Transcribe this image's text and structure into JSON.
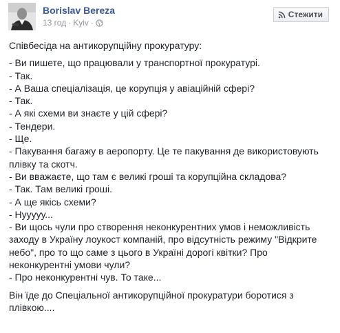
{
  "header": {
    "author_name": "Borislav Bereza",
    "time": "13 год",
    "separator": "·",
    "location": "Kyiv",
    "privacy_icon": "globe-icon",
    "follow_icon": "rss-icon",
    "follow_label": "Стежити"
  },
  "post": {
    "intro": "Співбесіда на антикорупційну прокуратуру:",
    "lines": [
      "- Ви пишете, що працювали у транспортної прокуратурі.",
      "- Так.",
      "- А Ваша спеціалізація, це корупція у авіаційній сфері?",
      "- Так.",
      "- А які схеми ви знаєте у цій сфері?",
      "- Тендери.",
      "- Ще.",
      "- Пакування багажу в аеропорту. Це те пакування де використовують",
      "плівку та скотч.",
      "- Ви вважаєте, що там є великі гроші та корупційна складова?",
      "- Так. Там великі гроші.",
      "- А ще якісь схеми?",
      "- Нууууу...",
      "- Ви щось чули про створення неконкурентних умов і неможливість",
      "заходу в Україну лоукост компаній, про відсутність режиму \"Відкрите",
      "небо\", про то що саме з цього в Україні дорогі квітки? Про",
      "неконкурентні умови чули?",
      "- Про неконкурентні чув. То таке..."
    ],
    "outro_lines": [
      "Він їде до Спеціальної антикорупційної прокуратури боротися з",
      "плівкою...."
    ]
  }
}
